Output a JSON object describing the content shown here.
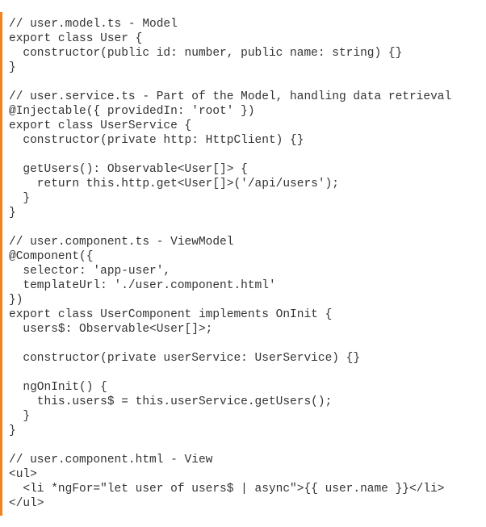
{
  "accent_color": "#f58220",
  "code_lines": [
    "// user.model.ts - Model",
    "export class User {",
    "  constructor(public id: number, public name: string) {}",
    "}",
    "",
    "// user.service.ts - Part of the Model, handling data retrieval",
    "@Injectable({ providedIn: 'root' })",
    "export class UserService {",
    "  constructor(private http: HttpClient) {}",
    "",
    "  getUsers(): Observable<User[]> {",
    "    return this.http.get<User[]>('/api/users');",
    "  }",
    "}",
    "",
    "// user.component.ts - ViewModel",
    "@Component({",
    "  selector: 'app-user',",
    "  templateUrl: './user.component.html'",
    "})",
    "export class UserComponent implements OnInit {",
    "  users$: Observable<User[]>;",
    "",
    "  constructor(private userService: UserService) {}",
    "",
    "  ngOnInit() {",
    "    this.users$ = this.userService.getUsers();",
    "  }",
    "}",
    "",
    "// user.component.html - View",
    "<ul>",
    "  <li *ngFor=\"let user of users$ | async\">{{ user.name }}</li>",
    "</ul>"
  ]
}
